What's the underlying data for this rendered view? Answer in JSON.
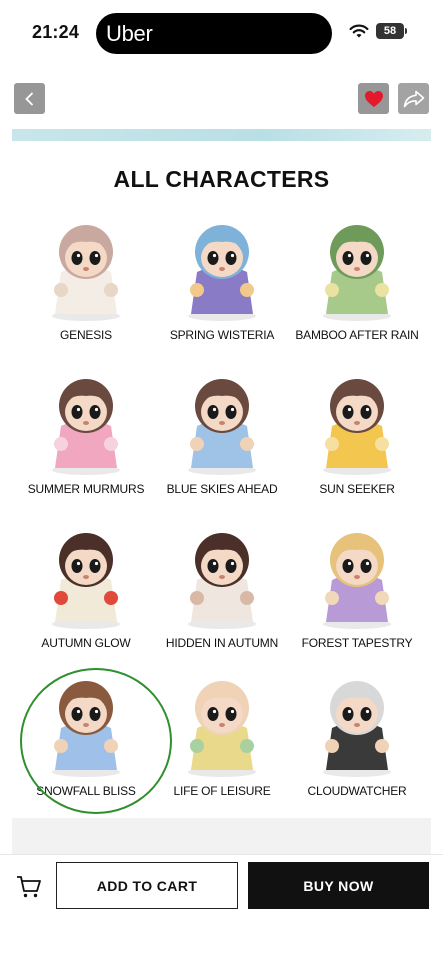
{
  "status_bar": {
    "time": "21:24",
    "live_activity": "Uber",
    "battery": "58"
  },
  "section": {
    "title": "ALL CHARACTERS"
  },
  "characters": [
    {
      "name": "GENESIS",
      "colors": [
        "#f3ede6",
        "#e8d6c7",
        "#c9a8a0"
      ]
    },
    {
      "name": "SPRING WISTERIA",
      "colors": [
        "#8a7bc6",
        "#f2c98a",
        "#7fb2d9"
      ]
    },
    {
      "name": "BAMBOO AFTER RAIN",
      "colors": [
        "#a7c98a",
        "#e9e2a0",
        "#6f9b5a"
      ]
    },
    {
      "name": "SUMMER MURMURS",
      "colors": [
        "#f1a7c0",
        "#f6d1de",
        "#6a4a3f"
      ]
    },
    {
      "name": "BLUE SKIES AHEAD",
      "colors": [
        "#9ec3e6",
        "#f0d2b6",
        "#6a4a3f"
      ]
    },
    {
      "name": "SUN SEEKER",
      "colors": [
        "#f3c64f",
        "#f6e0a0",
        "#6a4a3f"
      ]
    },
    {
      "name": "AUTUMN GLOW",
      "colors": [
        "#f1ead8",
        "#e04a3a",
        "#4a3028"
      ]
    },
    {
      "name": "HIDDEN IN AUTUMN",
      "colors": [
        "#eee6df",
        "#d9b9a6",
        "#4a3028"
      ]
    },
    {
      "name": "FOREST TAPESTRY",
      "colors": [
        "#b89ad6",
        "#f0d8b8",
        "#e6c27a"
      ]
    },
    {
      "name": "SNOWFALL BLISS",
      "colors": [
        "#9fc0e8",
        "#f0d2b6",
        "#8a5a3f"
      ]
    },
    {
      "name": "LIFE OF LEISURE",
      "colors": [
        "#e9d98a",
        "#a8d0a0",
        "#f0d2b6"
      ]
    },
    {
      "name": "CLOUDWATCHER",
      "colors": [
        "#3a3a3a",
        "#f0d2b6",
        "#d8d8d8"
      ]
    }
  ],
  "bottom_bar": {
    "add_to_cart": "ADD TO CART",
    "buy_now": "BUY NOW"
  },
  "colors": {
    "favorite": "#e3192c",
    "nav_button_bg": "#979797",
    "buy_button_bg": "#111111",
    "annotation_circle": "#2e8f2e"
  }
}
